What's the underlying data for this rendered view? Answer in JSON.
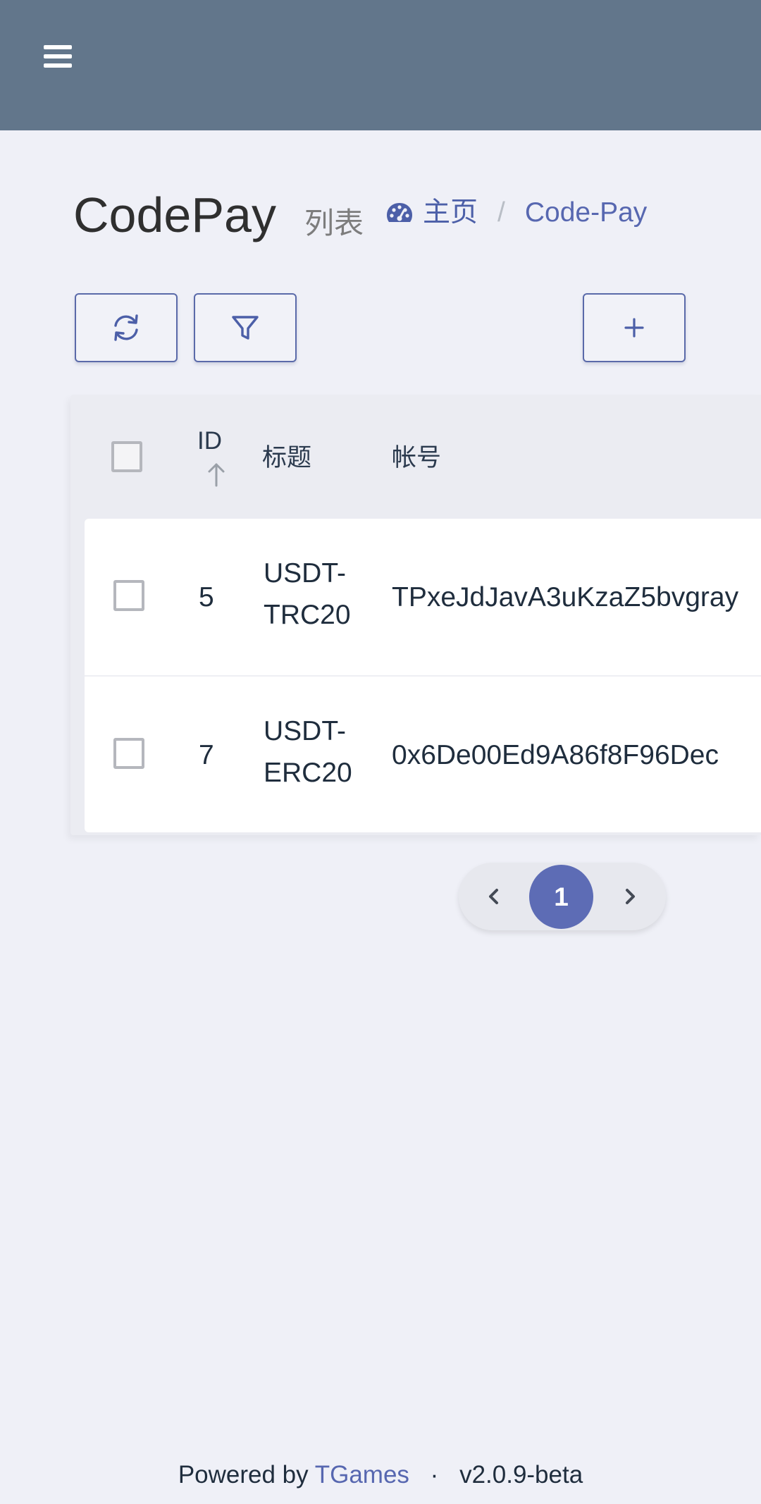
{
  "header": {
    "menu_icon": "hamburger-menu-icon",
    "bg_color": "#62768b"
  },
  "page": {
    "title": "CodePay",
    "subtitle": "列表"
  },
  "breadcrumb": {
    "home_icon": "dashboard-icon",
    "home_label": "主页",
    "separator": "/",
    "current": "Code-Pay"
  },
  "toolbar": {
    "refresh_icon": "refresh-icon",
    "filter_icon": "filter-icon",
    "add_icon": "plus-icon"
  },
  "table": {
    "columns": {
      "id": "ID",
      "title": "标题",
      "account": "帐号"
    },
    "sort": {
      "column": "ID",
      "direction": "ascending",
      "icon": "arrow-up-icon"
    },
    "rows": [
      {
        "id": "5",
        "title": "USDT-TRC20",
        "account": "TPxeJdJavA3uKzaZ5bvgray"
      },
      {
        "id": "7",
        "title": "USDT-ERC20",
        "account": "0x6De00Ed9A86f8F96Dec"
      }
    ]
  },
  "pagination": {
    "prev_icon": "chevron-left-icon",
    "current_page": "1",
    "next_icon": "chevron-right-icon"
  },
  "footer": {
    "prefix": "Powered by",
    "brand": "TGames",
    "separator": "·",
    "version": "v2.0.9-beta"
  },
  "colors": {
    "accent": "#5767b0",
    "page_background": "#eff0f7"
  }
}
